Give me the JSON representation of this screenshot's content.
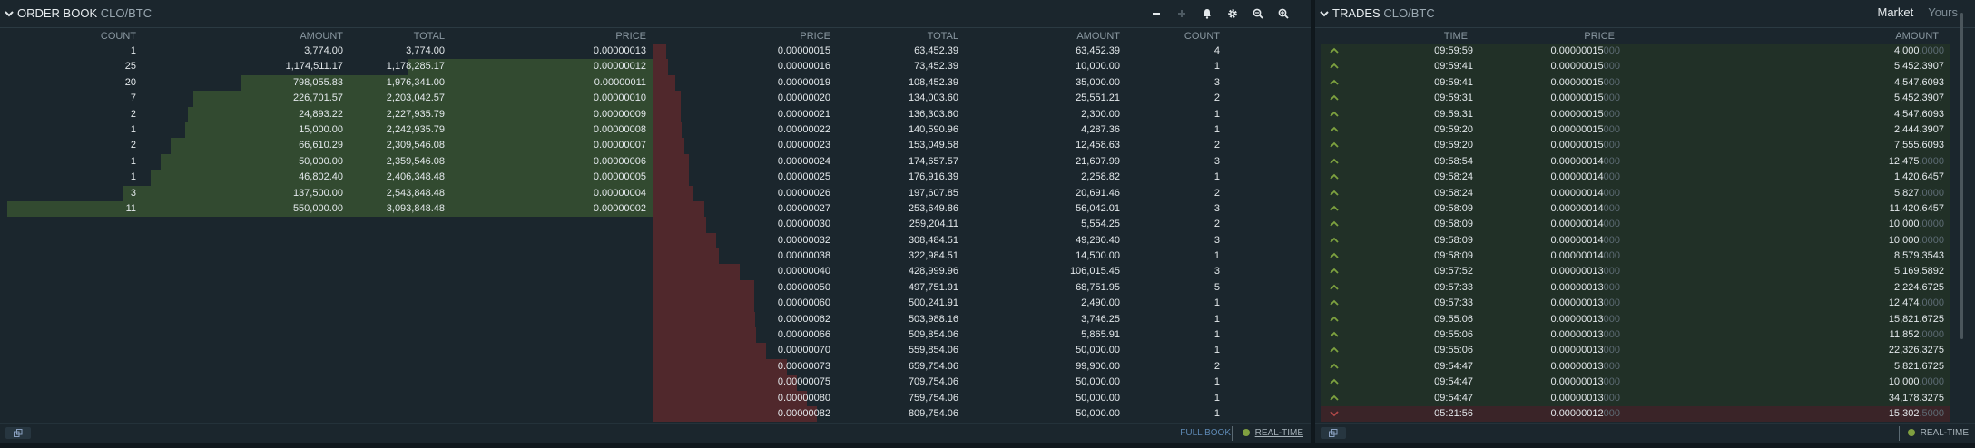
{
  "orderbook": {
    "title": "ORDER BOOK",
    "pair": "CLO/BTC",
    "headers": {
      "count": "COUNT",
      "amount": "AMOUNT",
      "total": "TOTAL",
      "price": "PRICE"
    },
    "bids": [
      {
        "count": "1",
        "amount": "3,774.00",
        "total": "3,774.00",
        "price": "0.00000013",
        "depth": 0.001
      },
      {
        "count": "25",
        "amount": "1,174,511.17",
        "total": "1,178,285.17",
        "price": "0.00000012",
        "depth": 0.381
      },
      {
        "count": "20",
        "amount": "798,055.83",
        "total": "1,976,341.00",
        "price": "0.00000011",
        "depth": 0.639
      },
      {
        "count": "7",
        "amount": "226,701.57",
        "total": "2,203,042.57",
        "price": "0.00000010",
        "depth": 0.712
      },
      {
        "count": "2",
        "amount": "24,893.22",
        "total": "2,227,935.79",
        "price": "0.00000009",
        "depth": 0.72
      },
      {
        "count": "1",
        "amount": "15,000.00",
        "total": "2,242,935.79",
        "price": "0.00000008",
        "depth": 0.725
      },
      {
        "count": "2",
        "amount": "66,610.29",
        "total": "2,309,546.08",
        "price": "0.00000007",
        "depth": 0.747
      },
      {
        "count": "1",
        "amount": "50,000.00",
        "total": "2,359,546.08",
        "price": "0.00000006",
        "depth": 0.763
      },
      {
        "count": "1",
        "amount": "46,802.40",
        "total": "2,406,348.48",
        "price": "0.00000005",
        "depth": 0.778
      },
      {
        "count": "3",
        "amount": "137,500.00",
        "total": "2,543,848.48",
        "price": "0.00000004",
        "depth": 0.822
      },
      {
        "count": "11",
        "amount": "550,000.00",
        "total": "3,093,848.48",
        "price": "0.00000002",
        "depth": 1.0
      }
    ],
    "asks": [
      {
        "price": "0.00000015",
        "total": "63,452.39",
        "amount": "63,452.39",
        "count": "4",
        "depth": 0.078
      },
      {
        "price": "0.00000016",
        "total": "73,452.39",
        "amount": "10,000.00",
        "count": "1",
        "depth": 0.091
      },
      {
        "price": "0.00000019",
        "total": "108,452.39",
        "amount": "35,000.00",
        "count": "3",
        "depth": 0.134
      },
      {
        "price": "0.00000020",
        "total": "134,003.60",
        "amount": "25,551.21",
        "count": "2",
        "depth": 0.166
      },
      {
        "price": "0.00000021",
        "total": "136,303.60",
        "amount": "2,300.00",
        "count": "1",
        "depth": 0.168
      },
      {
        "price": "0.00000022",
        "total": "140,590.96",
        "amount": "4,287.36",
        "count": "1",
        "depth": 0.174
      },
      {
        "price": "0.00000023",
        "total": "153,049.58",
        "amount": "12,458.63",
        "count": "2",
        "depth": 0.189
      },
      {
        "price": "0.00000024",
        "total": "174,657.57",
        "amount": "21,607.99",
        "count": "3",
        "depth": 0.216
      },
      {
        "price": "0.00000025",
        "total": "176,916.39",
        "amount": "2,258.82",
        "count": "1",
        "depth": 0.218
      },
      {
        "price": "0.00000026",
        "total": "197,607.85",
        "amount": "20,691.46",
        "count": "2",
        "depth": 0.244
      },
      {
        "price": "0.00000027",
        "total": "253,649.86",
        "amount": "56,042.01",
        "count": "3",
        "depth": 0.313
      },
      {
        "price": "0.00000030",
        "total": "259,204.11",
        "amount": "5,554.25",
        "count": "2",
        "depth": 0.32
      },
      {
        "price": "0.00000032",
        "total": "308,484.51",
        "amount": "49,280.40",
        "count": "3",
        "depth": 0.381
      },
      {
        "price": "0.00000038",
        "total": "322,984.51",
        "amount": "14,500.00",
        "count": "1",
        "depth": 0.399
      },
      {
        "price": "0.00000040",
        "total": "428,999.96",
        "amount": "106,015.45",
        "count": "3",
        "depth": 0.53
      },
      {
        "price": "0.00000050",
        "total": "497,751.91",
        "amount": "68,751.95",
        "count": "5",
        "depth": 0.615
      },
      {
        "price": "0.00000060",
        "total": "500,241.91",
        "amount": "2,490.00",
        "count": "1",
        "depth": 0.618
      },
      {
        "price": "0.00000062",
        "total": "503,988.16",
        "amount": "3,746.25",
        "count": "1",
        "depth": 0.622
      },
      {
        "price": "0.00000066",
        "total": "509,854.06",
        "amount": "5,865.91",
        "count": "1",
        "depth": 0.63
      },
      {
        "price": "0.00000070",
        "total": "559,854.06",
        "amount": "50,000.00",
        "count": "1",
        "depth": 0.691
      },
      {
        "price": "0.00000073",
        "total": "659,754.06",
        "amount": "99,900.00",
        "count": "2",
        "depth": 0.815
      },
      {
        "price": "0.00000075",
        "total": "709,754.06",
        "amount": "50,000.00",
        "count": "1",
        "depth": 0.876
      },
      {
        "price": "0.00000080",
        "total": "759,754.06",
        "amount": "50,000.00",
        "count": "1",
        "depth": 0.938
      },
      {
        "price": "0.00000082",
        "total": "809,754.06",
        "amount": "50,000.00",
        "count": "1",
        "depth": 1.0
      }
    ],
    "footer": {
      "full_book": "FULL BOOK",
      "realtime": "REAL-TIME"
    }
  },
  "trades": {
    "title": "TRADES",
    "pair": "CLO/BTC",
    "tabs": [
      "Market",
      "Yours"
    ],
    "headers": {
      "time": "TIME",
      "price": "PRICE",
      "amount": "AMOUNT"
    },
    "rows": [
      {
        "side": "buy",
        "time": "09:59:59",
        "price": "0.00000015",
        "price_pad": "000",
        "amount": "4,000",
        "amount_pad": ".0000"
      },
      {
        "side": "buy",
        "time": "09:59:41",
        "price": "0.00000015",
        "price_pad": "000",
        "amount": "5,452.3907",
        "amount_pad": ""
      },
      {
        "side": "buy",
        "time": "09:59:41",
        "price": "0.00000015",
        "price_pad": "000",
        "amount": "4,547.6093",
        "amount_pad": ""
      },
      {
        "side": "buy",
        "time": "09:59:31",
        "price": "0.00000015",
        "price_pad": "000",
        "amount": "5,452.3907",
        "amount_pad": ""
      },
      {
        "side": "buy",
        "time": "09:59:31",
        "price": "0.00000015",
        "price_pad": "000",
        "amount": "4,547.6093",
        "amount_pad": ""
      },
      {
        "side": "buy",
        "time": "09:59:20",
        "price": "0.00000015",
        "price_pad": "000",
        "amount": "2,444.3907",
        "amount_pad": ""
      },
      {
        "side": "buy",
        "time": "09:59:20",
        "price": "0.00000015",
        "price_pad": "000",
        "amount": "7,555.6093",
        "amount_pad": ""
      },
      {
        "side": "buy",
        "time": "09:58:54",
        "price": "0.00000014",
        "price_pad": "000",
        "amount": "12,475",
        "amount_pad": ".0000"
      },
      {
        "side": "buy",
        "time": "09:58:24",
        "price": "0.00000014",
        "price_pad": "000",
        "amount": "1,420.6457",
        "amount_pad": ""
      },
      {
        "side": "buy",
        "time": "09:58:24",
        "price": "0.00000014",
        "price_pad": "000",
        "amount": "5,827",
        "amount_pad": ".0000"
      },
      {
        "side": "buy",
        "time": "09:58:09",
        "price": "0.00000014",
        "price_pad": "000",
        "amount": "11,420.6457",
        "amount_pad": ""
      },
      {
        "side": "buy",
        "time": "09:58:09",
        "price": "0.00000014",
        "price_pad": "000",
        "amount": "10,000",
        "amount_pad": ".0000"
      },
      {
        "side": "buy",
        "time": "09:58:09",
        "price": "0.00000014",
        "price_pad": "000",
        "amount": "10,000",
        "amount_pad": ".0000"
      },
      {
        "side": "buy",
        "time": "09:58:09",
        "price": "0.00000014",
        "price_pad": "000",
        "amount": "8,579.3543",
        "amount_pad": ""
      },
      {
        "side": "buy",
        "time": "09:57:52",
        "price": "0.00000013",
        "price_pad": "000",
        "amount": "5,169.5892",
        "amount_pad": ""
      },
      {
        "side": "buy",
        "time": "09:57:33",
        "price": "0.00000013",
        "price_pad": "000",
        "amount": "2,224.6725",
        "amount_pad": ""
      },
      {
        "side": "buy",
        "time": "09:57:33",
        "price": "0.00000013",
        "price_pad": "000",
        "amount": "12,474",
        "amount_pad": ".0000"
      },
      {
        "side": "buy",
        "time": "09:55:06",
        "price": "0.00000013",
        "price_pad": "000",
        "amount": "15,821.6725",
        "amount_pad": ""
      },
      {
        "side": "buy",
        "time": "09:55:06",
        "price": "0.00000013",
        "price_pad": "000",
        "amount": "11,852",
        "amount_pad": ".0000"
      },
      {
        "side": "buy",
        "time": "09:55:06",
        "price": "0.00000013",
        "price_pad": "000",
        "amount": "22,326.3275",
        "amount_pad": ""
      },
      {
        "side": "buy",
        "time": "09:54:47",
        "price": "0.00000013",
        "price_pad": "000",
        "amount": "5,821.6725",
        "amount_pad": ""
      },
      {
        "side": "buy",
        "time": "09:54:47",
        "price": "0.00000013",
        "price_pad": "000",
        "amount": "10,000",
        "amount_pad": ".0000"
      },
      {
        "side": "buy",
        "time": "09:54:47",
        "price": "0.00000013",
        "price_pad": "000",
        "amount": "34,178.3275",
        "amount_pad": ""
      },
      {
        "side": "sell",
        "time": "05:21:56",
        "price": "0.00000012",
        "price_pad": "000",
        "amount": "15,302",
        "amount_pad": ".5000"
      }
    ],
    "footer": {
      "realtime": "REAL-TIME"
    }
  },
  "colors": {
    "background": "#1b262d",
    "bid_bar": "#324a30",
    "ask_bar": "#50282c",
    "buy_arrow": "#7ea23f",
    "sell_arrow": "#b04848",
    "realtime_dot": "#80a040",
    "full_book_link": "#5d88b3"
  },
  "icons": {
    "panel_collapse": "chevron-down-icon",
    "toolbar": [
      "minus-icon",
      "plus-icon",
      "bell-icon",
      "gear-icon",
      "zoom-out-icon",
      "zoom-in-icon"
    ],
    "footer": "popout-icon",
    "trade_buy": "arrow-up-icon",
    "trade_sell": "arrow-down-icon"
  }
}
